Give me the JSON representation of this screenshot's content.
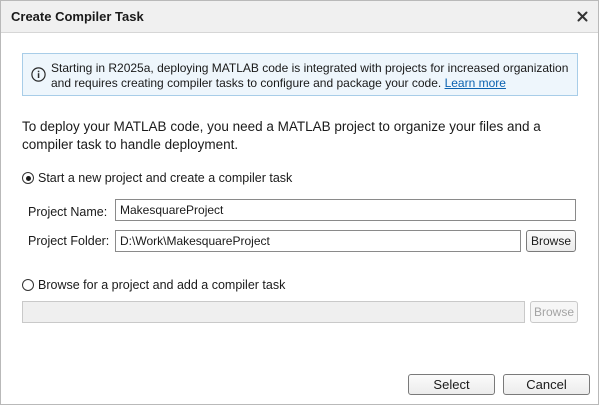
{
  "dialog": {
    "title": "Create Compiler Task",
    "close_icon": "close-icon"
  },
  "info": {
    "icon": "info-icon",
    "text": "Starting in R2025a, deploying MATLAB code is integrated with projects for increased organization and requires creating compiler tasks to configure and package your code. ",
    "link": "Learn more",
    "link_color": "#0b62b0"
  },
  "description": "To deploy your MATLAB code, you need a MATLAB project to organize your files and a compiler task to handle deployment.",
  "option_new": {
    "label": "Start a new project and create a compiler task",
    "selected": true,
    "project_name_label": "Project Name:",
    "project_name_value": "MakesquareProject",
    "project_folder_label": "Project Folder:",
    "project_folder_value": "D:\\Work\\MakesquareProject",
    "browse_label": "Browse"
  },
  "option_existing": {
    "label": "Browse for a project and add a compiler task",
    "selected": false,
    "path_value": "",
    "browse_label": "Browse"
  },
  "footer": {
    "select_label": "Select",
    "cancel_label": "Cancel"
  }
}
